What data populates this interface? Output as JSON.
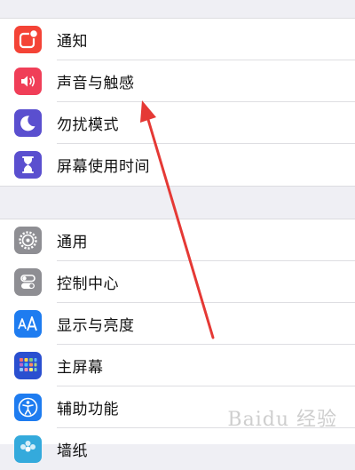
{
  "settings_group_1": [
    {
      "label": "通知",
      "icon": "notification-icon",
      "color": "#f44336"
    },
    {
      "label": "声音与触感",
      "icon": "speaker-icon",
      "color": "#f03e58"
    },
    {
      "label": "勿扰模式",
      "icon": "moon-icon",
      "color": "#5a4fcf"
    },
    {
      "label": "屏幕使用时间",
      "icon": "hourglass-icon",
      "color": "#5a4fcf"
    }
  ],
  "settings_group_2": [
    {
      "label": "通用",
      "icon": "gear-icon",
      "color": "#8e8e93"
    },
    {
      "label": "控制中心",
      "icon": "toggles-icon",
      "color": "#8e8e93"
    },
    {
      "label": "显示与亮度",
      "icon": "display-aa-icon",
      "color": "#1e7cf0"
    },
    {
      "label": "主屏幕",
      "icon": "home-grid-icon",
      "color": "#2a4fd0"
    },
    {
      "label": "辅助功能",
      "icon": "accessibility-icon",
      "color": "#1e7cf0"
    },
    {
      "label": "墙纸",
      "icon": "wallpaper-icon",
      "color": "#34aadc"
    }
  ],
  "annotation": {
    "color": "#e53935"
  },
  "watermark": {
    "text": "Baidu 经验"
  }
}
